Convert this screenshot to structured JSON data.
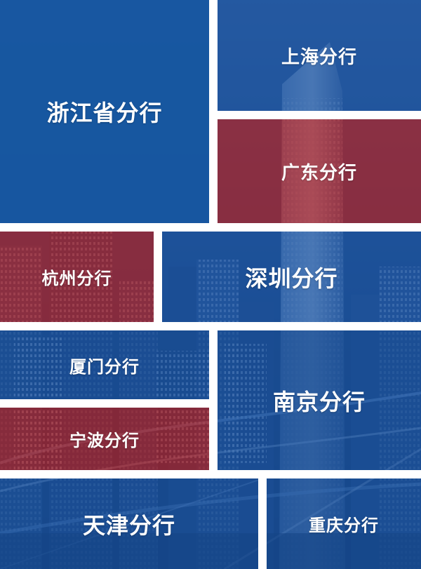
{
  "colors": {
    "blue": "#1656a0",
    "red": "#a0222c",
    "gap": "#ffffff"
  },
  "branches": [
    {
      "id": "zhejiang",
      "name": "浙江省分行",
      "theme": "blue"
    },
    {
      "id": "shanghai",
      "name": "上海分行",
      "theme": "blue"
    },
    {
      "id": "guangdong",
      "name": "广东分行",
      "theme": "red"
    },
    {
      "id": "hangzhou",
      "name": "杭州分行",
      "theme": "red"
    },
    {
      "id": "shenzhen",
      "name": "深圳分行",
      "theme": "blue"
    },
    {
      "id": "xiamen",
      "name": "厦门分行",
      "theme": "blue"
    },
    {
      "id": "nanjing",
      "name": "南京分行",
      "theme": "blue"
    },
    {
      "id": "ningbo",
      "name": "宁波分行",
      "theme": "red"
    },
    {
      "id": "tianjin",
      "name": "天津分行",
      "theme": "blue"
    },
    {
      "id": "chongqing",
      "name": "重庆分行",
      "theme": "blue"
    }
  ]
}
